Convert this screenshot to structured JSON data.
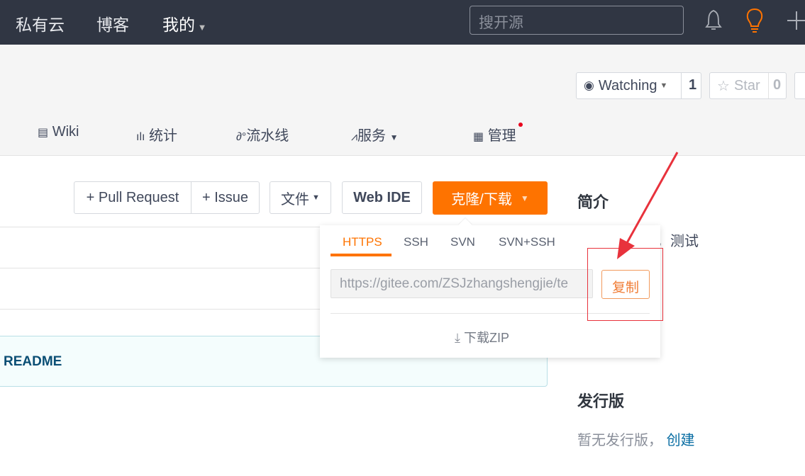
{
  "topbar": {
    "nav": [
      "私有云",
      "博客",
      "我的"
    ],
    "search_placeholder": "搜开源"
  },
  "repo": {
    "watch_label": "Watching",
    "watch_count": "1",
    "star_label": "Star",
    "star_count": "0"
  },
  "tabs": [
    "Wiki",
    "统计",
    "流水线",
    "服务",
    "管理"
  ],
  "toolbar": {
    "pull_request": "+ Pull Request",
    "issue": "+ Issue",
    "file": "文件",
    "webide": "Web IDE",
    "clone": "克隆/下载"
  },
  "clone_popup": {
    "tabs": [
      "HTTPS",
      "SSH",
      "SVN",
      "SVN+SSH"
    ],
    "active_tab": "HTTPS",
    "url": "https://gitee.com/ZSJzhangshengjie/te",
    "copy": "复制",
    "download_zip": "下载ZIP"
  },
  "readme": "README",
  "sidebar": {
    "intro_title": "简介",
    "intro_text": "仓库，测试",
    "release_title": "发行版",
    "release_empty": "暂无发行版，",
    "release_create": "创建"
  },
  "colors": {
    "accent": "#fe7300",
    "annotation": "#e8323c"
  }
}
